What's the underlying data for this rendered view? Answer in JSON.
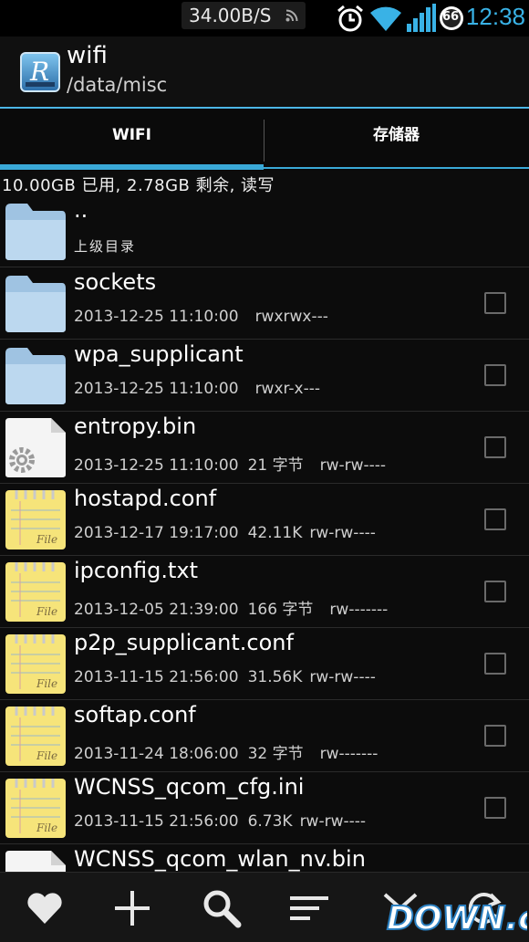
{
  "status_bar": {
    "net_speed": "34.00B/S",
    "battery_level": "66",
    "time": "12:38",
    "icons": [
      "rss-icon",
      "alarm-icon",
      "wifi-icon",
      "signal-icon",
      "battery-icon"
    ]
  },
  "action_bar": {
    "app_icon_letter": "R",
    "title": "wifi",
    "path": "/data/misc"
  },
  "tabs": [
    {
      "label": "WIFI",
      "selected": true
    },
    {
      "label": "存储器",
      "selected": false
    }
  ],
  "storage_info": "10.00GB 已用, 2.78GB 剩余, 读写",
  "parent": {
    "name": "..",
    "label": "上级目录"
  },
  "files": [
    {
      "name": "sockets",
      "date": "2013-12-25 11:10:00",
      "size": "",
      "perm": "rwxrwx---",
      "type": "folder"
    },
    {
      "name": "wpa_supplicant",
      "date": "2013-12-25 11:10:00",
      "size": "",
      "perm": "rwxr-x---",
      "type": "folder"
    },
    {
      "name": "entropy.bin",
      "date": "2013-12-25 11:10:00",
      "size": "21 字节",
      "perm": "rw-rw----",
      "type": "binary"
    },
    {
      "name": "hostapd.conf",
      "date": "2013-12-17 19:17:00",
      "size": "42.11K",
      "perm": "rw-rw----",
      "type": "text"
    },
    {
      "name": "ipconfig.txt",
      "date": "2013-12-05 21:39:00",
      "size": "166 字节",
      "perm": "rw-------",
      "type": "text"
    },
    {
      "name": "p2p_supplicant.conf",
      "date": "2013-11-15 21:56:00",
      "size": "31.56K",
      "perm": "rw-rw----",
      "type": "text"
    },
    {
      "name": "softap.conf",
      "date": "2013-11-24 18:06:00",
      "size": "32 字节",
      "perm": "rw-------",
      "type": "text"
    },
    {
      "name": "WCNSS_qcom_cfg.ini",
      "date": "2013-11-15 21:56:00",
      "size": "6.73K",
      "perm": "rw-rw----",
      "type": "text"
    },
    {
      "name": "WCNSS_qcom_wlan_nv.bin",
      "date": "",
      "size": "",
      "perm": "",
      "type": "binary"
    }
  ],
  "bottom_bar": {
    "buttons": [
      "favorite-icon",
      "add-icon",
      "search-icon",
      "sort-icon",
      "select-icon",
      "refresh-icon"
    ]
  },
  "watermark": "DOWN.cc",
  "colors": {
    "accent": "#3aa9d8",
    "clock": "#39b2e6",
    "folder": "#b9d6ee",
    "note": "#f6e47a"
  }
}
